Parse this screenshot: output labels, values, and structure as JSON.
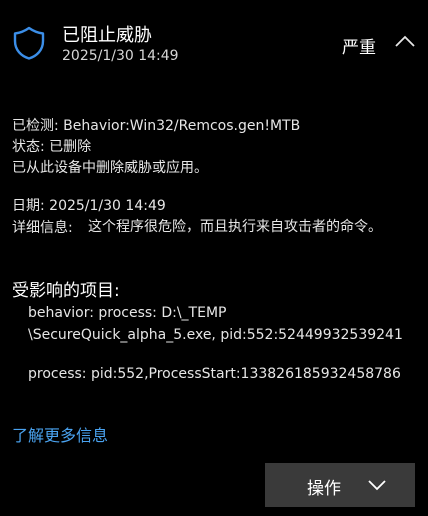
{
  "header": {
    "title": "已阻止威胁",
    "timestamp": "2025/1/30 14:49",
    "severity": "严重",
    "icon": "shield-icon",
    "collapse_icon": "chevron-up-icon"
  },
  "detection": {
    "detected_label": "已检测:",
    "detected_value": "Behavior:Win32/Remcos.gen!MTB",
    "status_label": "状态:",
    "status_value": "已删除",
    "status_note": "已从此设备中删除威胁或应用。"
  },
  "info": {
    "date_label": "日期:",
    "date_value": "2025/1/30 14:49",
    "details_label": "详细信息:",
    "details_value": "这个程序很危险，而且执行来自攻击者的命令。"
  },
  "affected": {
    "title": "受影响的项目:",
    "items": [
      {
        "line1": "behavior: process: D:\\_TEMP",
        "line2": "\\SecureQuick_alpha_5.exe, pid:552:52449932539241"
      },
      {
        "line1": "process: pid:552,ProcessStart:133826185932458786"
      }
    ]
  },
  "learn_more": "了解更多信息",
  "actions": {
    "label": "操作",
    "icon": "chevron-down-icon"
  },
  "colors": {
    "background": "#000000",
    "accent": "#4aa3f0",
    "shield": "#3b8ee8",
    "button": "#3a3a3a"
  }
}
